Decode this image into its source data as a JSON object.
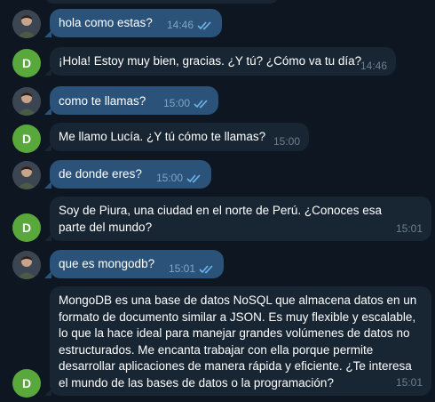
{
  "messages": [
    {
      "sender": "me",
      "text": "hola como estas?",
      "time": "14:46",
      "read": true
    },
    {
      "sender": "D",
      "text": "¡Hola! Estoy muy bien, gracias. ¿Y tú? ¿Cómo va tu día?",
      "time": "14:46"
    },
    {
      "sender": "me",
      "text": "como te llamas?",
      "time": "15:00",
      "read": true
    },
    {
      "sender": "D",
      "text": "Me llamo Lucía. ¿Y tú cómo te llamas?",
      "time": "15:00"
    },
    {
      "sender": "me",
      "text": "de donde eres?",
      "time": "15:00",
      "read": true
    },
    {
      "sender": "D",
      "text": "Soy de Piura, una ciudad en el norte de Perú. ¿Conoces esa parte del mundo?",
      "time": "15:01"
    },
    {
      "sender": "me",
      "text": "que es mongodb?",
      "time": "15:01",
      "read": true
    },
    {
      "sender": "D",
      "text": "MongoDB es una base de datos NoSQL que almacena datos en un formato de documento similar a JSON. Es muy flexible y escalable, lo que la hace ideal para manejar grandes volúmenes de datos no estructurados. Me encanta trabajar con ella porque permite desarrollar aplicaciones de manera rápida y eficiente. ¿Te interesa el mundo de las bases de datos o la programación?",
      "time": "15:01"
    }
  ],
  "avatar_letter": "D",
  "colors": {
    "background": "#0e1621",
    "outgoing": "#2b5278",
    "incoming": "#182533",
    "avatar_d": "#58a83b"
  }
}
